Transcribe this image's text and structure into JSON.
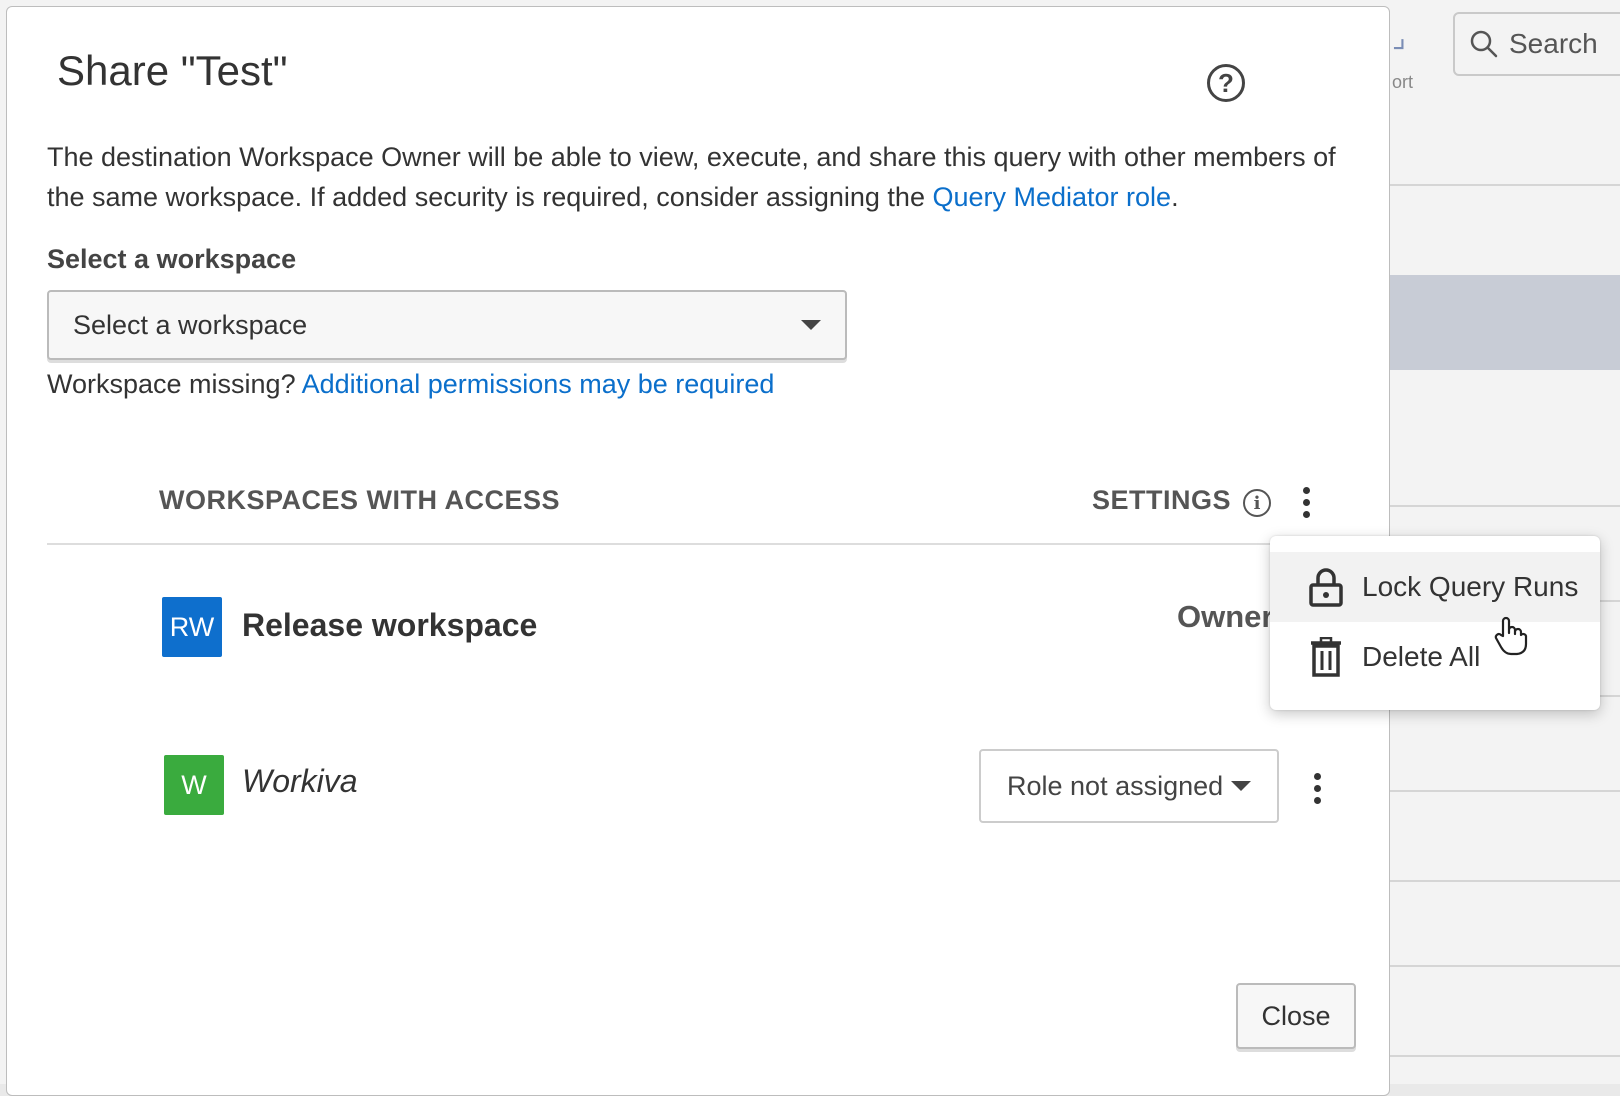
{
  "background": {
    "search_label": "Search",
    "fragment_text": "ort"
  },
  "dialog": {
    "title": "Share \"Test\"",
    "description_text": "The destination Workspace Owner will be able to view, execute, and share this query with other members of the same workspace. If added security is required, consider assigning the ",
    "description_link": "Query Mediator role",
    "description_end": ".",
    "workspace_label": "Select a workspace",
    "workspace_select_value": "Select a workspace",
    "missing_text": "Workspace missing? ",
    "missing_link": "Additional permissions may be required",
    "table": {
      "col_workspaces": "WORKSPACES WITH ACCESS",
      "col_settings": "SETTINGS",
      "rows": [
        {
          "avatar": "RW",
          "avatar_color": "#0e6fcd",
          "name": "Release workspace",
          "role": "Owner"
        },
        {
          "avatar": "W",
          "avatar_color": "#3aab3e",
          "name": "Workiva",
          "role": "Role not assigned"
        }
      ]
    },
    "menu": {
      "items": [
        {
          "label": "Lock Query Runs",
          "icon": "lock-icon"
        },
        {
          "label": "Delete All",
          "icon": "trash-icon"
        }
      ]
    },
    "close_label": "Close"
  },
  "colors": {
    "link": "#0b6fcb",
    "rw_avatar": "#0e6fcd",
    "w_avatar": "#3aab3e"
  }
}
